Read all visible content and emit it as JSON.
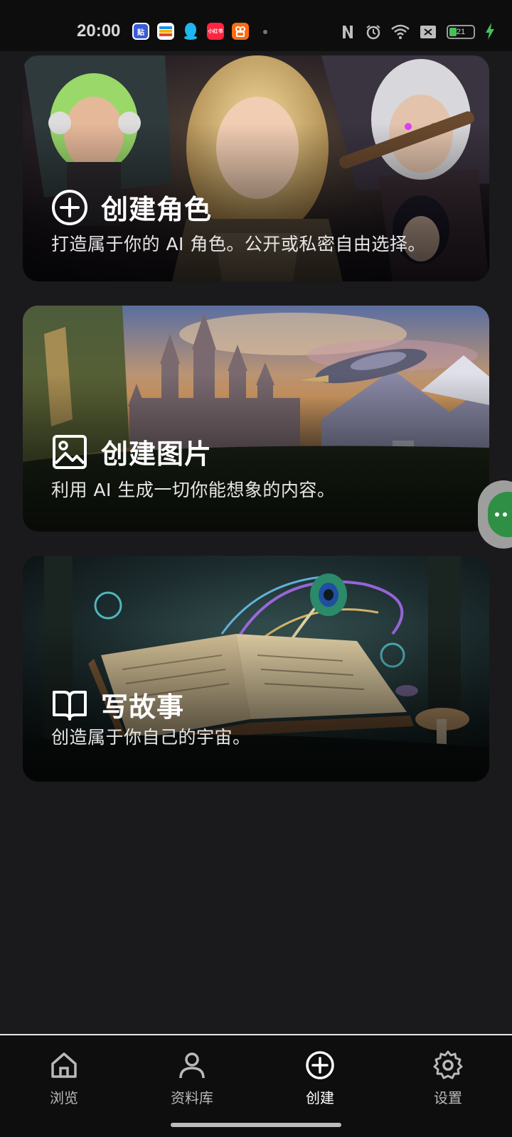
{
  "status_bar": {
    "time": "20:00",
    "battery_level": "21",
    "app_icons": [
      {
        "name": "tieba-app-icon",
        "label": "贴",
        "color": "#3b5bd6"
      },
      {
        "name": "wallet-app-icon",
        "label": "",
        "color": "#1f8ee9"
      },
      {
        "name": "qq-app-icon",
        "label": "",
        "color": "#1fb6f0"
      },
      {
        "name": "xiaohongshu-app-icon",
        "label": "小红书",
        "color": "#ff2442"
      },
      {
        "name": "kuaishou-app-icon",
        "label": "",
        "color": "#ff6a13"
      }
    ]
  },
  "cards": [
    {
      "id": "create-character",
      "icon": "plus-circle-icon",
      "title": "创建角色",
      "description": "打造属于你的 AI 角色。公开或私密自由选择。"
    },
    {
      "id": "create-image",
      "icon": "image-icon",
      "title": "创建图片",
      "description": "利用 AI 生成一切你能想象的内容。"
    },
    {
      "id": "write-story",
      "icon": "book-icon",
      "title": "写故事",
      "description": "创造属于你自己的宇宙。"
    }
  ],
  "bottom_nav": {
    "items": [
      {
        "label": "浏览",
        "icon": "home-icon"
      },
      {
        "label": "资料库",
        "icon": "person-icon"
      },
      {
        "label": "创建",
        "icon": "plus-circle-icon",
        "active": true
      },
      {
        "label": "设置",
        "icon": "gear-icon"
      }
    ]
  },
  "colors": {
    "background": "#1a1a1c",
    "accent_green": "#2f8f44",
    "battery_green": "#46c159"
  }
}
